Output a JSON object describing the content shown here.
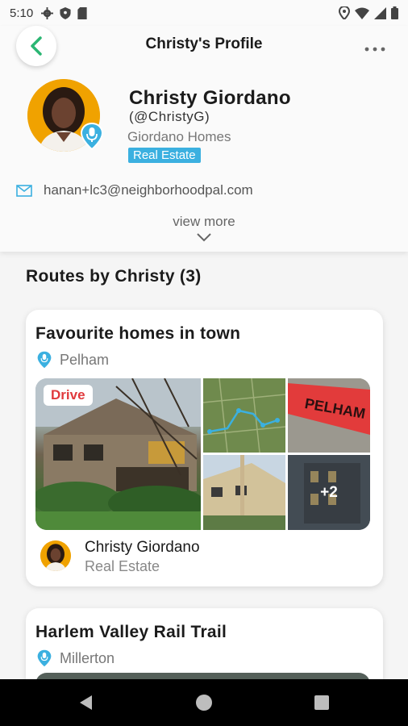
{
  "status_bar": {
    "time": "5:10"
  },
  "header": {
    "title": "Christy's Profile"
  },
  "profile": {
    "name": "Christy Giordano",
    "handle": "(@ChristyG)",
    "company": "Giordano Homes",
    "tag": "Real Estate",
    "email": "hanan+lc3@neighborhoodpal.com",
    "view_more": "view more"
  },
  "routes_section": {
    "title": "Routes by Christy (3)"
  },
  "routes": [
    {
      "title": "Favourite homes in town",
      "location": "Pelham",
      "mode": "Drive",
      "more_photos": "+2",
      "author_name": "Christy Giordano",
      "author_role": "Real Estate"
    },
    {
      "title": "Harlem Valley Rail Trail",
      "location": "Millerton"
    }
  ],
  "colors": {
    "accent": "#3bb0e0",
    "back_arrow": "#2bb673",
    "drive": "#e0393c",
    "avatar_bg": "#f0a200"
  }
}
